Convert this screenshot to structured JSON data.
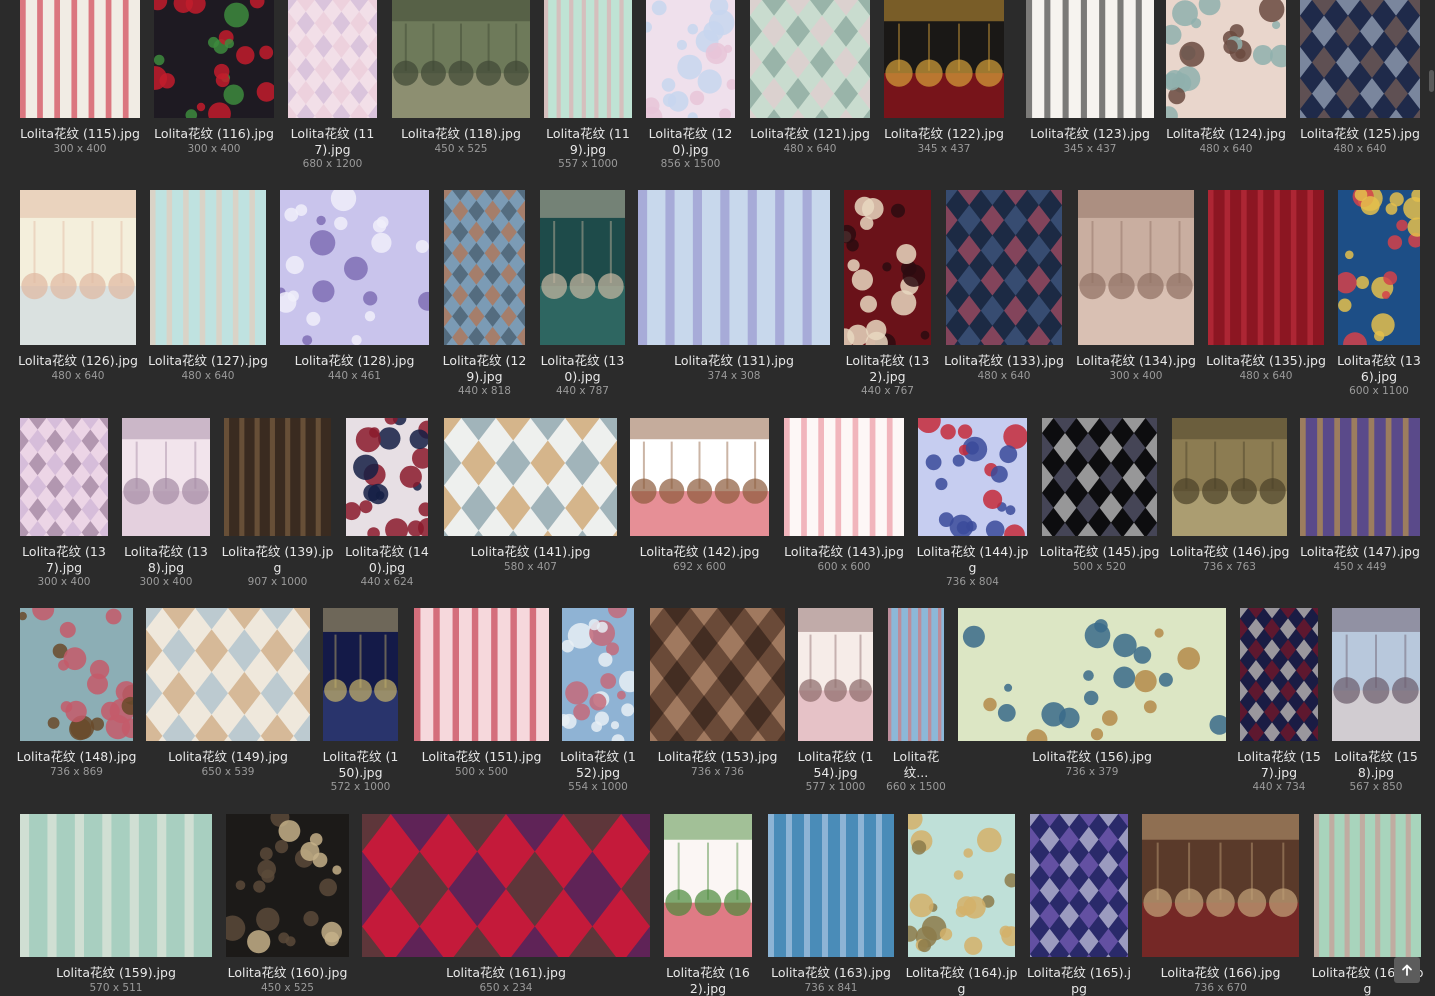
{
  "tiles": [
    {
      "name": "Lolita花纹 (115).jpg",
      "dims": "300 x 400",
      "icon": "strawberry-pattern"
    },
    {
      "name": "Lolita花纹 (116).jpg",
      "dims": "300 x 400",
      "icon": "strawberry-pattern-dark"
    },
    {
      "name": "Lolita花纹 (117).jpg",
      "dims": "680 x 1200",
      "icon": "pastel-pattern"
    },
    {
      "name": "Lolita花纹 (118).jpg",
      "dims": "450 x 525",
      "icon": "clock-pattern"
    },
    {
      "name": "Lolita花纹 (119).jpg",
      "dims": "557 x 1000",
      "icon": "donut-pattern"
    },
    {
      "name": "Lolita花纹 (120).jpg",
      "dims": "856 x 1500",
      "icon": "pastel-castle-pattern"
    },
    {
      "name": "Lolita花纹 (121).jpg",
      "dims": "480 x 640",
      "icon": "stripe-lace-pattern"
    },
    {
      "name": "Lolita花纹 (122).jpg",
      "dims": "345 x 437",
      "icon": "royal-crest"
    },
    {
      "name": "Lolita花纹 (123).jpg",
      "dims": "345 x 437",
      "icon": "puss-in-boots"
    },
    {
      "name": "Lolita花纹 (124).jpg",
      "dims": "480 x 640",
      "icon": "gothic-arch-pattern"
    },
    {
      "name": "Lolita花纹 (125).jpg",
      "dims": "480 x 640",
      "icon": "gothic-arch-navy"
    },
    {
      "name": "Lolita花纹 (126).jpg",
      "dims": "480 x 640",
      "icon": "birdcage-pattern"
    },
    {
      "name": "Lolita花纹 (127).jpg",
      "dims": "480 x 640",
      "icon": "birdcage-mint"
    },
    {
      "name": "Lolita花纹 (128).jpg",
      "dims": "440 x 461",
      "icon": "lavender-floral"
    },
    {
      "name": "Lolita花纹 (129).jpg",
      "dims": "440 x 818",
      "icon": "fairytale-scene"
    },
    {
      "name": "Lolita花纹 (130).jpg",
      "dims": "440 x 787",
      "icon": "argyle-teal"
    },
    {
      "name": "Lolita花纹 (131).jpg",
      "dims": "374 x 308",
      "icon": "teddy-bear"
    },
    {
      "name": "Lolita花纹 (132).jpg",
      "dims": "440 x 767",
      "icon": "red-stripe"
    },
    {
      "name": "Lolita花纹 (133).jpg",
      "dims": "480 x 640",
      "icon": "navy-argyle"
    },
    {
      "name": "Lolita花纹 (134).jpg",
      "dims": "300 x 400",
      "icon": "taupe-stripe"
    },
    {
      "name": "Lolita花纹 (135).jpg",
      "dims": "480 x 640",
      "icon": "red-argyle"
    },
    {
      "name": "Lolita花纹 (136).jpg",
      "dims": "600 x 1100",
      "icon": "blue-toy-pattern"
    },
    {
      "name": "Lolita花纹 (137).jpg",
      "dims": "300 x 400",
      "icon": "pink-bow"
    },
    {
      "name": "Lolita花纹 (138).jpg",
      "dims": "300 x 400",
      "icon": "pale-pink-bow"
    },
    {
      "name": "Lolita花纹 (139).jpg",
      "dims": "907 x 1000",
      "icon": "brown-panel"
    },
    {
      "name": "Lolita花纹 (140).jpg",
      "dims": "440 x 624",
      "icon": "tricolor-panel"
    },
    {
      "name": "Lolita花纹 (141).jpg",
      "dims": "580 x 407",
      "icon": "butterfly-mushroom"
    },
    {
      "name": "Lolita花纹 (142).jpg",
      "dims": "692 x 600",
      "icon": "cake-strawberry"
    },
    {
      "name": "Lolita花纹 (143).jpg",
      "dims": "600 x 600",
      "icon": "strawberry-scatter"
    },
    {
      "name": "Lolita花纹 (144).jpg",
      "dims": "736 x 804",
      "icon": "blue-tea-party"
    },
    {
      "name": "Lolita花纹 (145).jpg",
      "dims": "500 x 520",
      "icon": "black-snowflake"
    },
    {
      "name": "Lolita花纹 (146).jpg",
      "dims": "736 x 763",
      "icon": "olive-stripe"
    },
    {
      "name": "Lolita花纹 (147).jpg",
      "dims": "450 x 449",
      "icon": "moon-pattern"
    },
    {
      "name": "Lolita花纹 (148).jpg",
      "dims": "736 x 869",
      "icon": "frame-wall"
    },
    {
      "name": "Lolita花纹 (149).jpg",
      "dims": "650 x 539",
      "icon": "shop-facade"
    },
    {
      "name": "Lolita花纹 (150).jpg",
      "dims": "572 x 1000",
      "icon": "navy-starry"
    },
    {
      "name": "Lolita花纹 (151).jpg",
      "dims": "500 x 500",
      "icon": "rose-floral"
    },
    {
      "name": "Lolita花纹 (152).jpg",
      "dims": "554 x 1000",
      "icon": "blue-check"
    },
    {
      "name": "Lolita花纹 (153).jpg",
      "dims": "736 x 736",
      "icon": "cameo-brown"
    },
    {
      "name": "Lolita花纹 (154).jpg",
      "dims": "577 x 1000",
      "icon": "pearl-rose"
    },
    {
      "name": "Lolita花纹...",
      "dims": "660 x 1500",
      "icon": "alice-pattern"
    },
    {
      "name": "Lolita花纹 (156).jpg",
      "dims": "736 x 379",
      "icon": "peacock-arch"
    },
    {
      "name": "Lolita花纹 (157).jpg",
      "dims": "440 x 734",
      "icon": "tricolor-stripe"
    },
    {
      "name": "Lolita花纹 (158).jpg",
      "dims": "567 x 850",
      "icon": "cameo-blue"
    },
    {
      "name": "Lolita花纹 (159).jpg",
      "dims": "570 x 511",
      "icon": "mint-cameo"
    },
    {
      "name": "Lolita花纹 (160).jpg",
      "dims": "450 x 525",
      "icon": "library-dark"
    },
    {
      "name": "Lolita花纹 (161).jpg",
      "dims": "650 x 234",
      "icon": "carnival-argyle"
    },
    {
      "name": "Lolita花纹 (162).jpg",
      "dims": "",
      "icon": "cherry-scatter"
    },
    {
      "name": "Lolita花纹 (163).jpg",
      "dims": "736 x 841",
      "icon": "blue-carousel"
    },
    {
      "name": "Lolita花纹 (164).jpg",
      "dims": "",
      "icon": "mint-gold"
    },
    {
      "name": "Lolita花纹 (165).jpg",
      "dims": "",
      "icon": "starry-swan"
    },
    {
      "name": "Lolita花纹 (166).jpg",
      "dims": "736 x 670",
      "icon": "brown-theatre"
    },
    {
      "name": "Lolita花纹 (167).jpg",
      "dims": "",
      "icon": "green-rose-stripe"
    }
  ],
  "colors": {
    "background": "#2b2b2b",
    "filename": "#e8e8e8",
    "dimensions": "#9a9a9a"
  },
  "back_to_top_icon": "arrow-up-icon"
}
